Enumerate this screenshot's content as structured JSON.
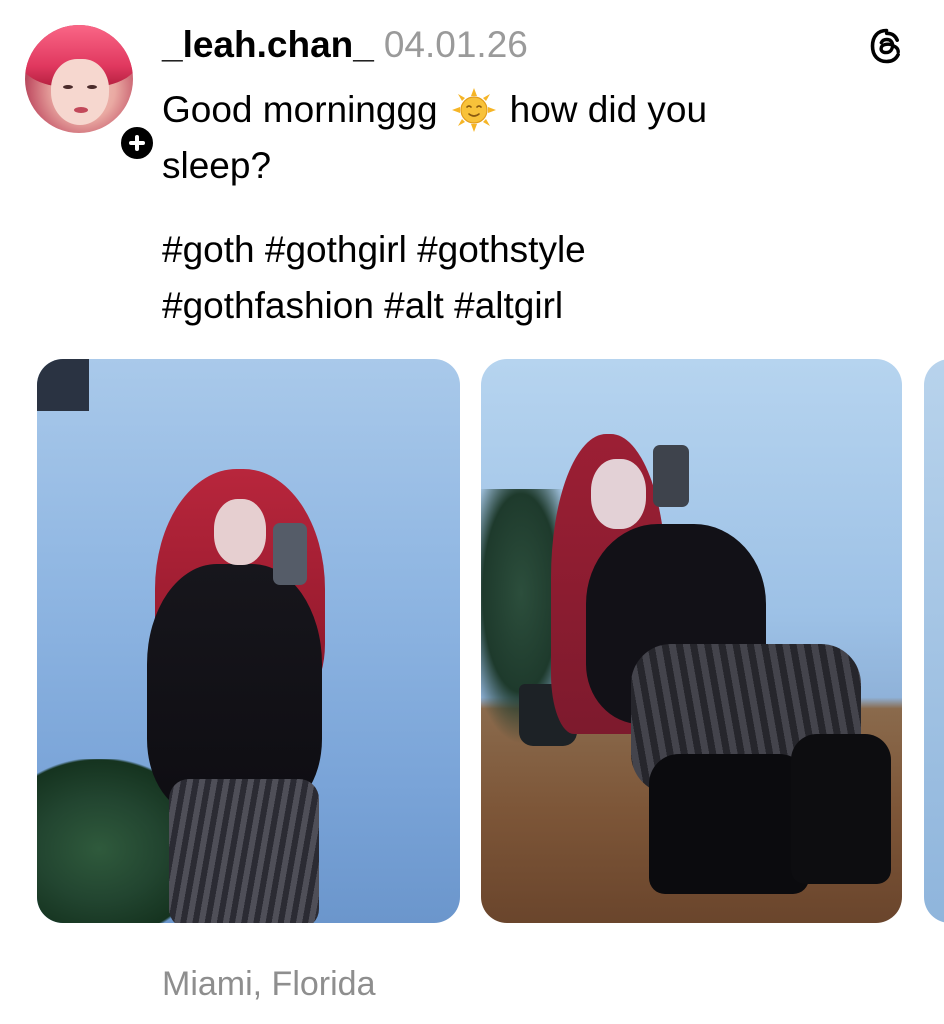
{
  "post": {
    "username": "_leah.chan_",
    "date": "04.01.26",
    "text_line1_a": "Good morninggg",
    "text_line1_b": "how did you",
    "text_line2": "sleep?",
    "hashtags_line1": "#goth #gothgirl #gothstyle",
    "hashtags_line2": "#gothfashion #alt #altgirl",
    "location": "Miami, Florida"
  },
  "icons": {
    "sun": "sun-with-face-emoji",
    "follow": "plus-icon",
    "app": "threads-logo-icon"
  },
  "colors": {
    "text": "#000000",
    "muted": "#9a9a9a",
    "location": "#8e8e8e",
    "background": "#ffffff"
  }
}
